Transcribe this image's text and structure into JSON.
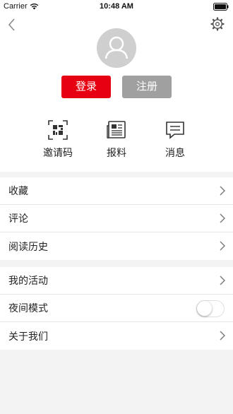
{
  "status_bar": {
    "carrier": "Carrier",
    "time": "10:48 AM"
  },
  "header": {
    "login_label": "登录",
    "register_label": "注册"
  },
  "features": [
    {
      "label": "邀请码",
      "icon": "qr-code-icon"
    },
    {
      "label": "报料",
      "icon": "newspaper-icon"
    },
    {
      "label": "消息",
      "icon": "message-icon"
    }
  ],
  "menu_group_1": [
    {
      "label": "收藏"
    },
    {
      "label": "评论"
    },
    {
      "label": "阅读历史"
    }
  ],
  "menu_group_2": [
    {
      "label": "我的活动"
    },
    {
      "label": "夜间模式",
      "toggle": false
    },
    {
      "label": "关于我们"
    }
  ],
  "colors": {
    "accent": "#e60012",
    "secondary_button": "#a0a0a0",
    "background": "#f3f3f3"
  }
}
